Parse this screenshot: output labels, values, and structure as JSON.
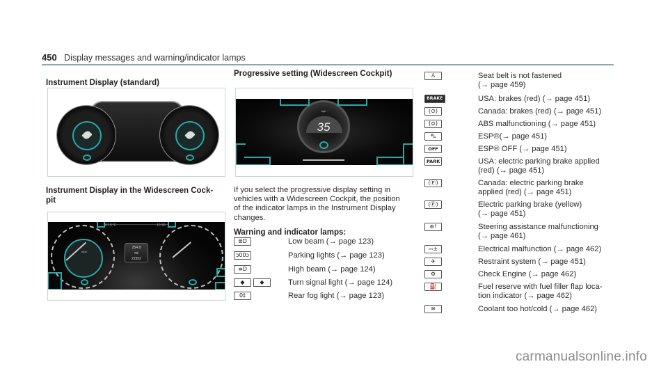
{
  "header": {
    "page_number": "450",
    "title": "Display messages and warning/indicator lamps"
  },
  "column1": {
    "section1_heading": "Instrument Display (standard)",
    "section2_heading_line1": "Instrument Display in the Widescreen Cock-",
    "section2_heading_line2": "pit",
    "widescreen_display": {
      "top_left_readout": "81.5 °F",
      "top_right_readout": "10:30",
      "center_value_top": "254.8",
      "center_value_mid": "mi",
      "center_value_bottom": "22352",
      "speedo_ticks": [
        "20",
        "40",
        "60",
        "80",
        "100",
        "120",
        "140",
        "160"
      ],
      "speedo_unit": "mph",
      "tacho_ticks": [
        "1",
        "2",
        "3",
        "4",
        "5",
        "6",
        "7",
        "8"
      ]
    }
  },
  "column2": {
    "section_heading": "Progressive setting (Widescreen Cockpit)",
    "progressive_display": {
      "speed_value": "35",
      "speed_unit": "mph"
    },
    "paragraph_lines": [
      "If you select the progressive display setting in",
      "vehicles with a Widescreen Cockpit, the position",
      "of the indicator lamps in the Instrument Display",
      "changes."
    ],
    "lamps_heading": "Warning and indicator lamps:",
    "lamps": [
      {
        "icons": [
          "low-beam"
        ],
        "glyphs": [
          "≣D"
        ],
        "lines": [
          "Low beam (→ page 123)"
        ]
      },
      {
        "icons": [
          "parking-lights"
        ],
        "glyphs": [
          "ↄ00ↄ"
        ],
        "lines": [
          "Parking lights (→ page 123)"
        ]
      },
      {
        "icons": [
          "high-beam"
        ],
        "glyphs": [
          "≡D"
        ],
        "lines": [
          "High beam (→ page 124)"
        ]
      },
      {
        "icons": [
          "turn-signal-left",
          "turn-signal-right"
        ],
        "glyphs": [
          "◆",
          "◆"
        ],
        "lines": [
          "Turn signal light (→ page 124)"
        ]
      },
      {
        "icons": [
          "rear-fog-light"
        ],
        "glyphs": [
          "0‡"
        ],
        "lines": [
          "Rear fog light (→ page 123)"
        ]
      }
    ]
  },
  "column3": {
    "lamps": [
      {
        "icon": "seat-belt",
        "glyph": "♙",
        "style": "box",
        "lines": [
          "Seat belt is not fastened",
          "(→ page 459)"
        ]
      },
      {
        "icon": "brake-usa",
        "glyph": "BRAKE",
        "style": "solid",
        "lines": [
          "USA: brakes (red) (→ page 451)"
        ]
      },
      {
        "icon": "brake-canada",
        "glyph": "(⊙)",
        "style": "box",
        "lines": [
          "Canada: brakes (red) (→ page 451)"
        ]
      },
      {
        "icon": "abs",
        "glyph": "(⊜)",
        "style": "box",
        "lines": [
          "ABS malfunctioning (→ page 451)"
        ]
      },
      {
        "icon": "esp",
        "glyph": "⛍",
        "style": "box",
        "lines": [
          "ESP®(→ page 451)"
        ]
      },
      {
        "icon": "esp-off",
        "glyph": "OFF",
        "style": "text",
        "lines": [
          "ESP® OFF (→ page 451)"
        ]
      },
      {
        "icon": "park-usa",
        "glyph": "PARK",
        "style": "text",
        "lines": [
          "USA: electric parking brake applied",
          "(red) (→ page 451)"
        ]
      },
      {
        "icon": "park-canada",
        "glyph": "(Ⓟ)",
        "style": "box",
        "lines": [
          "Canada: electric parking brake",
          "applied (red) (→ page 451)"
        ]
      },
      {
        "icon": "electric-parking-brake",
        "glyph": "(Ⓟ)",
        "style": "box",
        "lines": [
          "Electric parking brake (yellow)",
          "(→ page 451)"
        ]
      },
      {
        "icon": "steering-assist",
        "glyph": "⊛!",
        "style": "box",
        "lines": [
          "Steering assistance malfunctioning",
          "(→ page 461)"
        ]
      },
      {
        "icon": "battery",
        "glyph": "⎓±",
        "style": "box",
        "lines": [
          "Electrical malfunction (→ page 462)"
        ]
      },
      {
        "icon": "restraint-system",
        "glyph": "✈",
        "style": "box",
        "lines": [
          "Restraint system (→ page 451)"
        ]
      },
      {
        "icon": "check-engine",
        "glyph": "⚙",
        "style": "box",
        "lines": [
          "Check Engine (→ page 462)"
        ]
      },
      {
        "icon": "fuel-reserve",
        "glyph": "⛽",
        "style": "box",
        "lines": [
          "Fuel reserve with fuel filler flap loca-",
          "tion indicator (→ page 462)"
        ]
      },
      {
        "icon": "coolant",
        "glyph": "≋",
        "style": "box",
        "lines": [
          "Coolant too hot/cold (→ page 462)"
        ]
      }
    ]
  },
  "watermark": "carmanualsonline.info",
  "colors": {
    "accent_teal": "#2aa8a8",
    "rule": "#8fa8a6",
    "text": "#2b2b2b"
  }
}
